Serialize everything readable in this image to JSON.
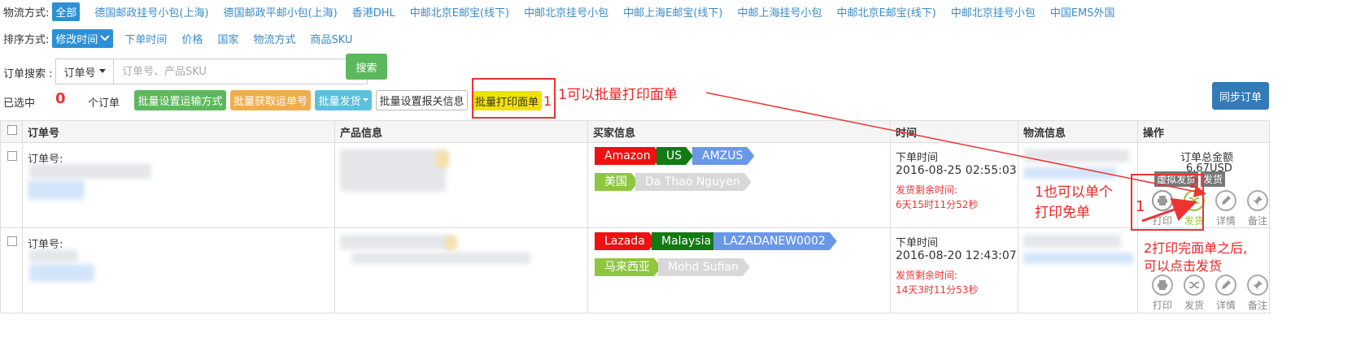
{
  "filters": {
    "logistics_label": "物流方式:",
    "logistics_options": [
      "全部",
      "德国邮政挂号小包(上海)",
      "德国邮政平邮小包(上海)",
      "香港DHL",
      "中邮北京E邮宝(线下)",
      "中邮北京挂号小包",
      "中邮上海E邮宝(线下)",
      "中邮上海挂号小包",
      "中邮北京E邮宝(线下)",
      "中邮北京挂号小包",
      "中国EMS外国"
    ],
    "sort_label": "排序方式:",
    "sort_selected": "修改时间",
    "sort_options": [
      "下单时间",
      "价格",
      "国家",
      "物流方式",
      "商品SKU"
    ]
  },
  "search": {
    "label": "订单搜索 :",
    "type": "订单号",
    "placeholder": "订单号、产品SKU",
    "button": "搜索"
  },
  "selection": {
    "prefix": "已选中",
    "count": "0",
    "suffix": "个订单"
  },
  "actions": {
    "batch_shipping": "批量设置运输方式",
    "batch_tracking": "批量获取运单号",
    "batch_ship": "批量发货",
    "batch_customs": "批量设置报关信息",
    "batch_print": "批量打印面单",
    "sync": "同步订单"
  },
  "annotations": {
    "a1_num": "1",
    "a1_text": "1可以批量打印面单",
    "a2": "1也可以单个",
    "a3": "打印免单",
    "a4_num": "1",
    "a5_num": "2",
    "a6": "2打印完面单之后,",
    "a7": "可以点击发货"
  },
  "table": {
    "headers": [
      "订单号",
      "产品信息",
      "买家信息",
      "时间",
      "物流信息",
      "操作"
    ],
    "order_label": "订单号:",
    "time_label": "下单时间",
    "remain_label": "发货剩余时间:",
    "rows": [
      {
        "platform": "Amazon",
        "country_code": "US",
        "store": "AMZUS",
        "country": "美国",
        "buyer": "Da Thao Nguyen",
        "time": "2016-08-25 02:55:03",
        "remaining": "6天15时11分52秒",
        "total_label": "订单总金额",
        "total": "6.67USD",
        "virtual_ship": "虚拟发货",
        "ship_btn": "发货"
      },
      {
        "platform": "Lazada",
        "country_code": "Malaysia",
        "store": "LAZADANEW0002",
        "country": "马来西亚",
        "buyer": "Mohd Sufian",
        "time": "2016-08-20 12:43:07",
        "remaining": "14天3时11分53秒"
      }
    ],
    "op_labels": [
      "打印",
      "发货",
      "详情",
      "备注"
    ]
  },
  "colors": {
    "link": "#3a8bc9",
    "accent": "#2d8fd5",
    "annotation": "#ee2222"
  }
}
